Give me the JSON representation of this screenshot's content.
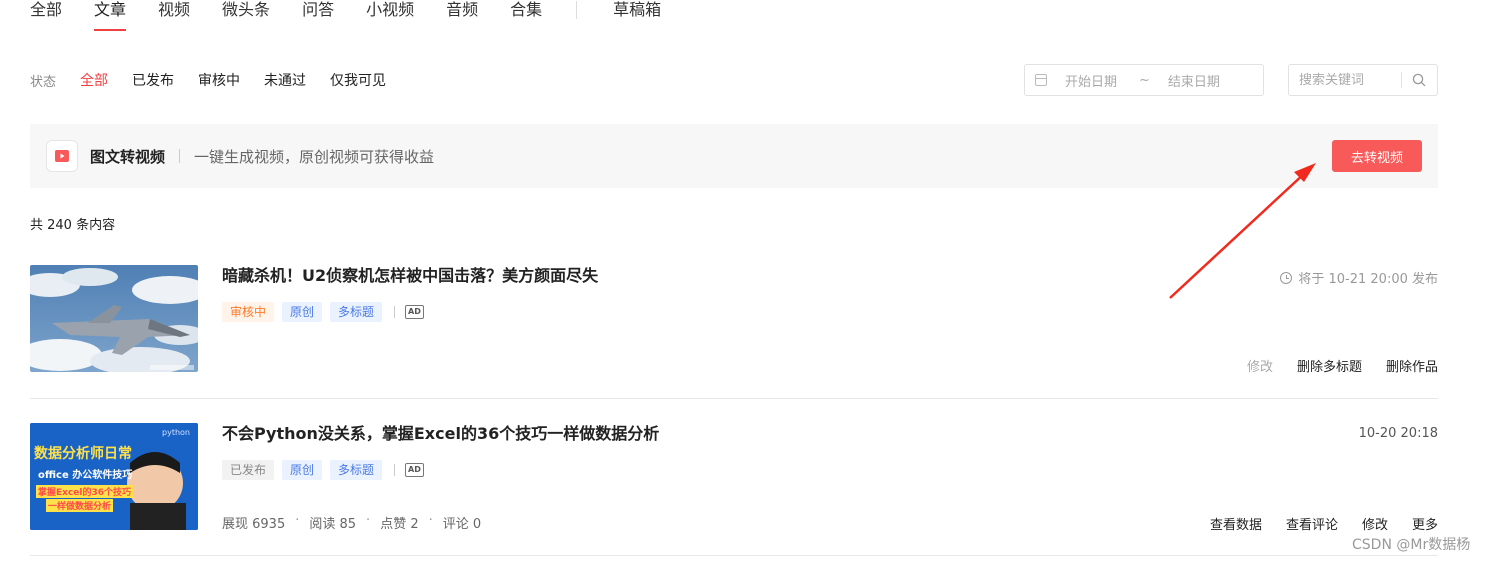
{
  "tabs": [
    {
      "label": "全部"
    },
    {
      "label": "文章"
    },
    {
      "label": "视频"
    },
    {
      "label": "微头条"
    },
    {
      "label": "问答"
    },
    {
      "label": "小视频"
    },
    {
      "label": "音频"
    },
    {
      "label": "合集"
    }
  ],
  "drafts_tab": "草稿箱",
  "status": {
    "label": "状态",
    "options": [
      {
        "label": "全部"
      },
      {
        "label": "已发布"
      },
      {
        "label": "审核中"
      },
      {
        "label": "未通过"
      },
      {
        "label": "仅我可见"
      }
    ]
  },
  "date_range": {
    "start_placeholder": "开始日期",
    "separator": "~",
    "end_placeholder": "结束日期"
  },
  "search": {
    "placeholder": "搜索关键词"
  },
  "banner": {
    "title": "图文转视频",
    "description": "一键生成视频，原创视频可获得收益",
    "button": "去转视频"
  },
  "total_count": "共 240 条内容",
  "articles": [
    {
      "title": "暗藏杀机！U2侦察机怎样被中国击落？美方颜面尽失",
      "tags": [
        "审核中",
        "原创",
        "多标题"
      ],
      "ad_label": "AD",
      "time": "将于 10-21 20:00 发布",
      "actions": [
        "修改",
        "删除多标题",
        "删除作品"
      ]
    },
    {
      "title": "不会Python没关系，掌握Excel的36个技巧一样做数据分析",
      "tags": [
        "已发布",
        "原创",
        "多标题"
      ],
      "ad_label": "AD",
      "time": "10-20 20:18",
      "stats": {
        "impressions": "展现 6935",
        "reads": "阅读 85",
        "likes": "点赞 2",
        "comments": "评论 0"
      },
      "thumb_text": {
        "line1": "数据分析师日常",
        "line2": "office 办公软件技巧",
        "line3": "掌握Excel的36个技巧",
        "line4": "一样做数据分析",
        "corner": "python"
      },
      "actions": [
        "查看数据",
        "查看评论",
        "修改",
        "更多"
      ]
    }
  ],
  "watermark": "CSDN @Mr数据杨",
  "colors": {
    "accent": "#f04142",
    "button": "#f85959",
    "annotation_arrow": "#f02a1e"
  }
}
